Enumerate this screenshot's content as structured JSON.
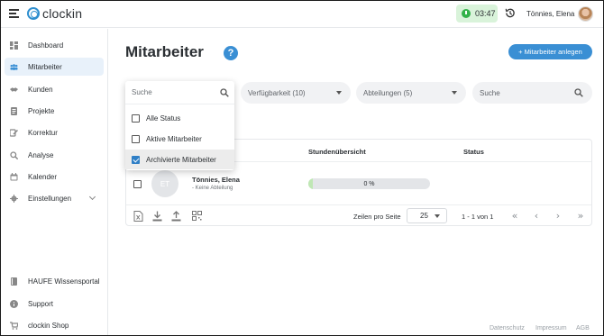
{
  "app": {
    "logo_text": "clockin"
  },
  "topbar": {
    "timer": "03:47",
    "user_name": "Tönnies, Elena"
  },
  "sidebar": {
    "items": [
      {
        "label": "Dashboard",
        "icon": "dashboard-icon"
      },
      {
        "label": "Mitarbeiter",
        "icon": "people-icon",
        "active": true
      },
      {
        "label": "Kunden",
        "icon": "handshake-icon"
      },
      {
        "label": "Projekte",
        "icon": "projects-icon"
      },
      {
        "label": "Korrektur",
        "icon": "edit-icon"
      },
      {
        "label": "Analyse",
        "icon": "analysis-icon"
      },
      {
        "label": "Kalender",
        "icon": "calendar-icon"
      },
      {
        "label": "Einstellungen",
        "icon": "gear-icon"
      }
    ],
    "bottom_items": [
      {
        "label": "HAUFE Wissensportal",
        "icon": "book-icon"
      },
      {
        "label": "Support",
        "icon": "info-icon"
      },
      {
        "label": "clockin Shop",
        "icon": "cart-icon"
      }
    ]
  },
  "main": {
    "title": "Mitarbeiter",
    "help_symbol": "?",
    "add_button": "+ Mitarbeiter anlegen",
    "filters": {
      "availability": "Verfügbarkeit (10)",
      "departments": "Abteilungen (5)",
      "search_placeholder": "Suche"
    }
  },
  "status_dropdown": {
    "search_placeholder": "Suche",
    "options": [
      {
        "label": "Alle Status",
        "checked": false
      },
      {
        "label": "Aktive Mitarbeiter",
        "checked": false
      },
      {
        "label": "Archivierte Mitarbeiter",
        "checked": true
      }
    ]
  },
  "table": {
    "headers": {
      "hours": "Stundenübersicht",
      "status": "Status"
    },
    "rows": [
      {
        "initials": "ET",
        "name": "Tönnies, Elena",
        "department": "- Keine Abteilung",
        "progress_text": "0 %",
        "progress_fraction": 0.04,
        "status": ""
      }
    ],
    "footer": {
      "rows_per_page_label": "Zeilen pro Seite",
      "rows_per_page_value": "25",
      "page_range": "1 - 1 von 1"
    }
  },
  "footer_links": [
    "Datenschutz",
    "Impressum",
    "AGB"
  ],
  "colors": {
    "accent": "#3a8fd4",
    "timer_bg": "#d9f3da",
    "timer_icon": "#33b24a",
    "progress_fill": "#bfe7b4"
  }
}
